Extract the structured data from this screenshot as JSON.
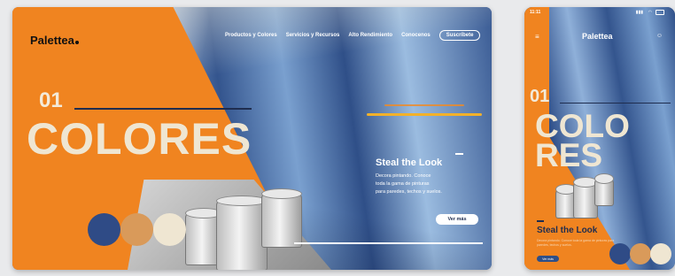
{
  "desktop": {
    "logo": "Palettea",
    "nav": [
      "Productos y Colores",
      "Servicios y Recursos",
      "Alto Rendimiento",
      "Conocenos"
    ],
    "subscribe_label": "Suscríbete",
    "section_number": "01",
    "section_title": "COLORES",
    "steal_title": "Steal the Look",
    "steal_desc": "Decora pintando. Conoce\ntoda la gama de pinturas\npara paredes, techos y suelos.",
    "cta_label": "Ver más",
    "swatches": [
      "#2f4b86",
      "#d99a5a",
      "#efe6d2"
    ]
  },
  "mobile": {
    "time": "11:11",
    "logo": "Palettea",
    "section_number": "01",
    "section_title_line1": "COLO",
    "section_title_line2": "RES",
    "steal_title": "Steal the Look",
    "steal_desc": "Decora pintando. Conoce toda la gama de pinturas para paredes, techos y suelos.",
    "cta_label": "Ver más",
    "swatches": [
      "#2f4b86",
      "#d99a5a",
      "#efe6d2"
    ]
  },
  "colors": {
    "accent_orange": "#f08420",
    "navy": "#1f2d4f",
    "cream": "#efe6d2"
  }
}
